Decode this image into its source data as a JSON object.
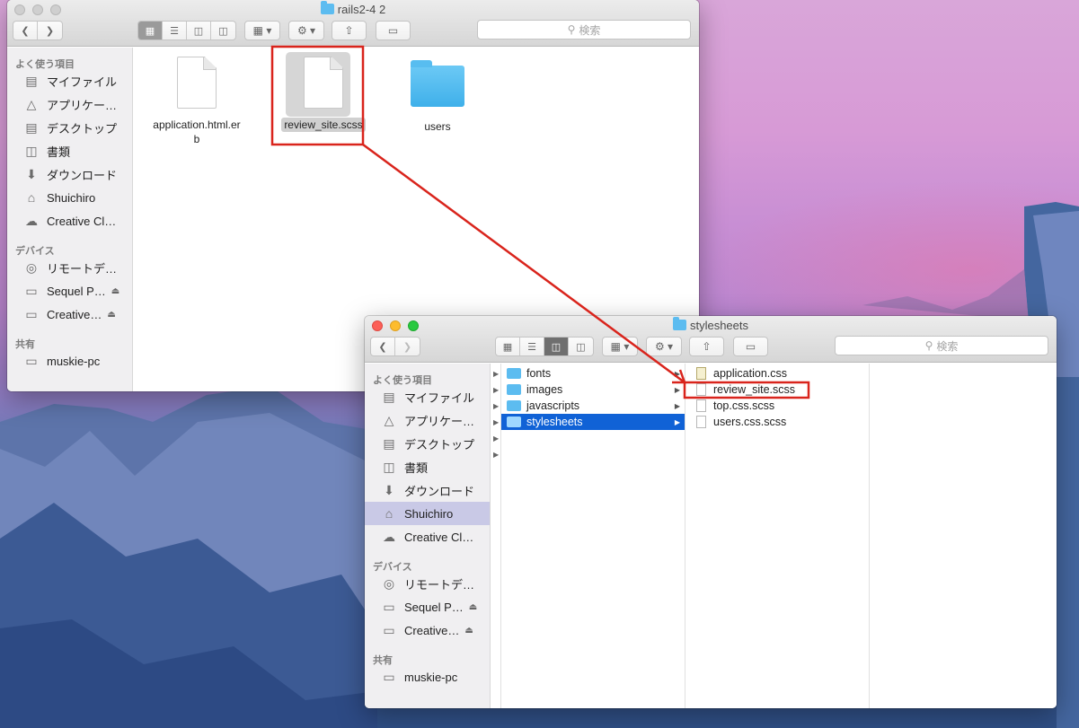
{
  "window_back": {
    "title": "rails2-4 2",
    "search_placeholder": "検索",
    "sidebar": {
      "favorites_head": "よく使う項目",
      "favorites": [
        {
          "label": "マイファイル",
          "icon": "allfiles-icon"
        },
        {
          "label": "アプリケー…",
          "icon": "applications-icon"
        },
        {
          "label": "デスクトップ",
          "icon": "desktop-icon"
        },
        {
          "label": "書類",
          "icon": "documents-icon"
        },
        {
          "label": "ダウンロード",
          "icon": "download-icon"
        },
        {
          "label": "Shuichiro",
          "icon": "home-icon"
        },
        {
          "label": "Creative Cl…",
          "icon": "creative-cloud-icon"
        }
      ],
      "devices_head": "デバイス",
      "devices": [
        {
          "label": "リモートデ…",
          "icon": "remote-disc-icon"
        },
        {
          "label": "Sequel P…",
          "icon": "disk-icon"
        },
        {
          "label": "Creative…",
          "icon": "disk-icon"
        }
      ],
      "shared_head": "共有",
      "shared": [
        {
          "label": "muskie-pc",
          "icon": "computer-icon"
        }
      ]
    },
    "files": [
      {
        "name": "application.html.erb",
        "kind": "document"
      },
      {
        "name": "review_site.scss",
        "kind": "document",
        "selected": true
      },
      {
        "name": "users",
        "kind": "folder"
      }
    ]
  },
  "window_front": {
    "title": "stylesheets",
    "search_placeholder": "検索",
    "sidebar": {
      "favorites_head": "よく使う項目",
      "favorites": [
        {
          "label": "マイファイル",
          "icon": "allfiles-icon"
        },
        {
          "label": "アプリケー…",
          "icon": "applications-icon"
        },
        {
          "label": "デスクトップ",
          "icon": "desktop-icon"
        },
        {
          "label": "書類",
          "icon": "documents-icon"
        },
        {
          "label": "ダウンロード",
          "icon": "download-icon"
        },
        {
          "label": "Shuichiro",
          "icon": "home-icon",
          "selected": true
        },
        {
          "label": "Creative Cl…",
          "icon": "creative-cloud-icon"
        }
      ],
      "devices_head": "デバイス",
      "devices": [
        {
          "label": "リモートデ…",
          "icon": "remote-disc-icon"
        },
        {
          "label": "Sequel P…",
          "icon": "disk-icon"
        },
        {
          "label": "Creative…",
          "icon": "disk-icon"
        }
      ],
      "shared_head": "共有",
      "shared": [
        {
          "label": "muskie-pc",
          "icon": "computer-icon"
        }
      ]
    },
    "column2": [
      "fonts",
      "images",
      "javascripts",
      "stylesheets"
    ],
    "column3": [
      "application.css",
      "review_site.scss",
      "top.css.scss",
      "users.css.scss"
    ]
  },
  "colors": {
    "annotation_red": "#d9241c",
    "selection_blue": "#1062d6",
    "folder_blue": "#5cbcf0"
  }
}
